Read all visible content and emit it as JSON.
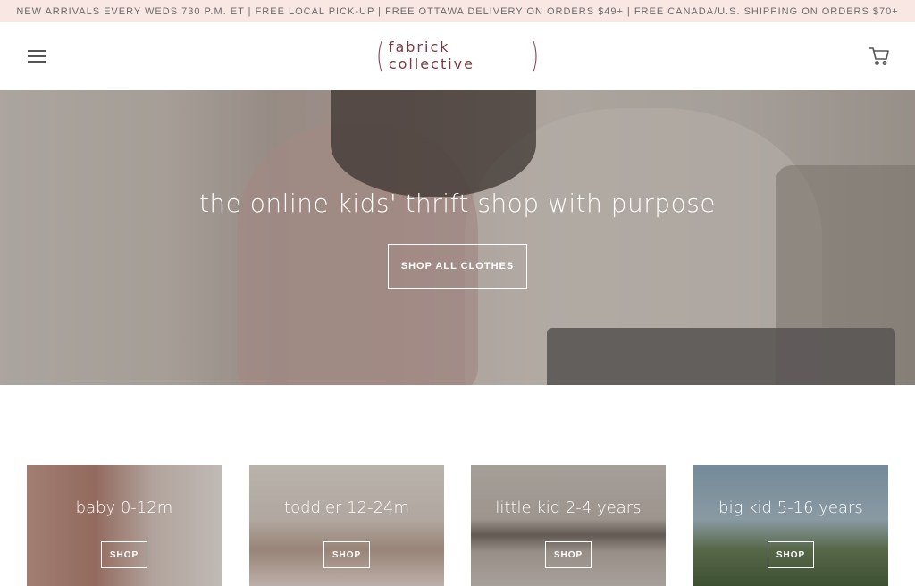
{
  "announcement": "NEW ARRIVALS EVERY WEDS 730 P.M. ET | FREE LOCAL PICK-UP | FREE OTTAWA DELIVERY ON ORDERS $49+ | FREE CANADA/U.S. SHIPPING ON ORDERS $70+",
  "header": {
    "logo_text": "fabrick collective",
    "menu_icon": "hamburger-menu-icon",
    "cart_icon": "shopping-cart-icon"
  },
  "hero": {
    "title": "the online kids' thrift shop with purpose",
    "button_label": "SHOP ALL CLOTHES"
  },
  "categories": [
    {
      "label": "baby 0-12m",
      "button": "SHOP"
    },
    {
      "label": "toddler 12-24m",
      "button": "SHOP"
    },
    {
      "label": "little kid 2-4 years",
      "button": "SHOP"
    },
    {
      "label": "big kid 5-16 years",
      "button": "SHOP"
    }
  ],
  "colors": {
    "announcement_bg": "#f9e7e3",
    "logo": "#7a3a40",
    "hero_overlay_text": "#ffffff"
  }
}
